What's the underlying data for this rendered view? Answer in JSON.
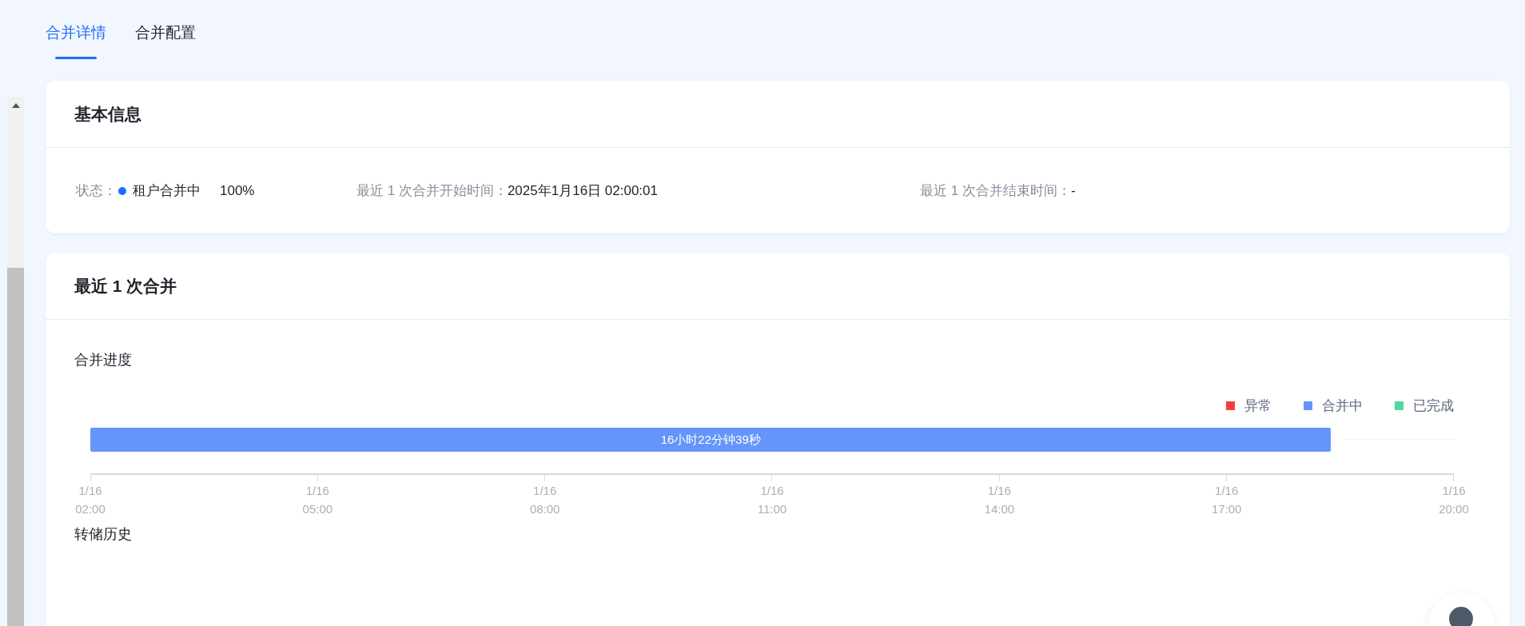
{
  "tabs": [
    {
      "label": "合并详情",
      "selected": true
    },
    {
      "label": "合并配置",
      "selected": false
    }
  ],
  "basic_info": {
    "title": "基本信息",
    "status": {
      "label": "状态：",
      "value": "租户合并中",
      "percent": "100%",
      "color": "#1a6dff"
    },
    "fields": [
      {
        "label": "最近 1 次合并开始时间：",
        "value": "2025年1月16日 02:00:01"
      },
      {
        "label": "最近 1 次合并结束时间：",
        "value": "-"
      }
    ]
  },
  "last_merge": {
    "title": "最近 1 次合并",
    "progress": {
      "title": "合并进度",
      "legend": [
        {
          "label": "异常",
          "color": "#f53f3f"
        },
        {
          "label": "合并中",
          "color": "#6495fa"
        },
        {
          "label": "已完成",
          "color": "#55d6a0"
        }
      ],
      "bar": {
        "label": "16小时22分钟39秒",
        "level": 0.91,
        "color": "#6495fa"
      },
      "ticks": [
        {
          "date": "1/16",
          "time": "02:00"
        },
        {
          "date": "1/16",
          "time": "05:00"
        },
        {
          "date": "1/16",
          "time": "08:00"
        },
        {
          "date": "1/16",
          "time": "11:00"
        },
        {
          "date": "1/16",
          "time": "14:00"
        },
        {
          "date": "1/16",
          "time": "17:00"
        },
        {
          "date": "1/16",
          "time": "20:00"
        }
      ]
    },
    "history": {
      "title": "转储历史"
    }
  }
}
